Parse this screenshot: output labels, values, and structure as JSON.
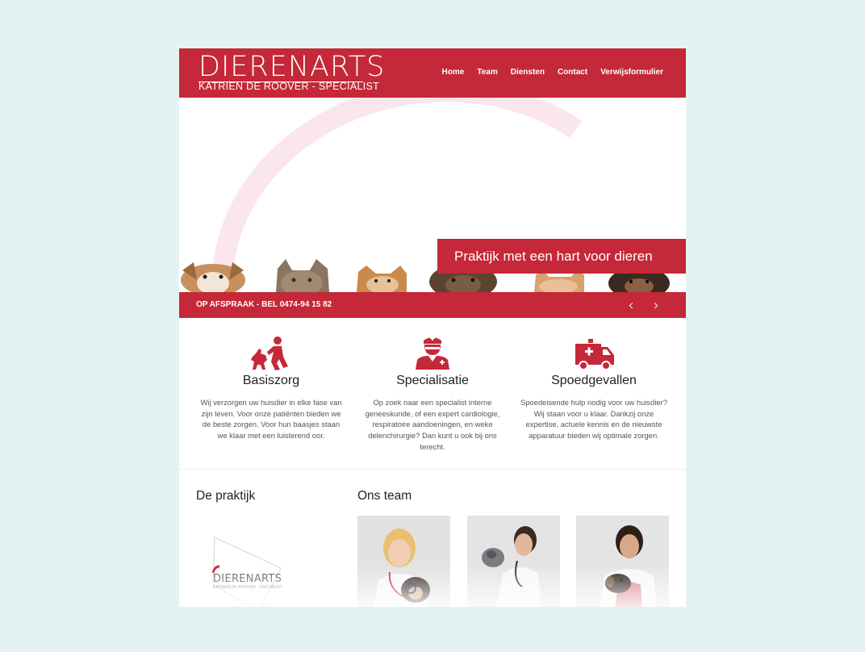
{
  "brand": {
    "title": "DIERENARTS",
    "subtitle": "KATRIEN DE ROOVER - SPECIALIST",
    "color": "#c52838"
  },
  "nav": {
    "items": [
      "Home",
      "Team",
      "Diensten",
      "Contact",
      "Verwijsformulier"
    ]
  },
  "hero": {
    "banner_text": "Praktijk met een hart voor dieren",
    "call_text": "OP AFSPRAAK - BEL 0474-94 15 82",
    "prev_icon": "chevron-left-icon",
    "next_icon": "chevron-right-icon"
  },
  "features": [
    {
      "icon": "vet-with-dog-icon",
      "title": "Basiszorg",
      "text": "Wij verzorgen uw huisdier in elke fase van zijn leven. Voor onze patiënten bieden we de beste zorgen. Voor hun baasjes staan we klaar met een luisterend oor."
    },
    {
      "icon": "nurse-icon",
      "title": "Specialisatie",
      "text": "Op zoek naar een specialist interne geneeskunde, of een expert cardiologie, respiratoire aandoeningen, en weke delenchirurgie? Dan kunt u ook bij ons terecht."
    },
    {
      "icon": "ambulance-icon",
      "title": "Spoedgevallen",
      "text": "Spoedeisende hulp nodig voor uw huisdier? Wij staan voor u klaar. Dankzij onze expertise, actuele kennis en de nieuwste apparatuur bieden wij optimale zorgen."
    }
  ],
  "sections": {
    "practice_title": "De praktijk",
    "team_title": "Ons team"
  },
  "logo_badge": {
    "title": "DIERENARTS",
    "subtitle": "KATRIEN DE ROOVER - SPECIALIST"
  }
}
